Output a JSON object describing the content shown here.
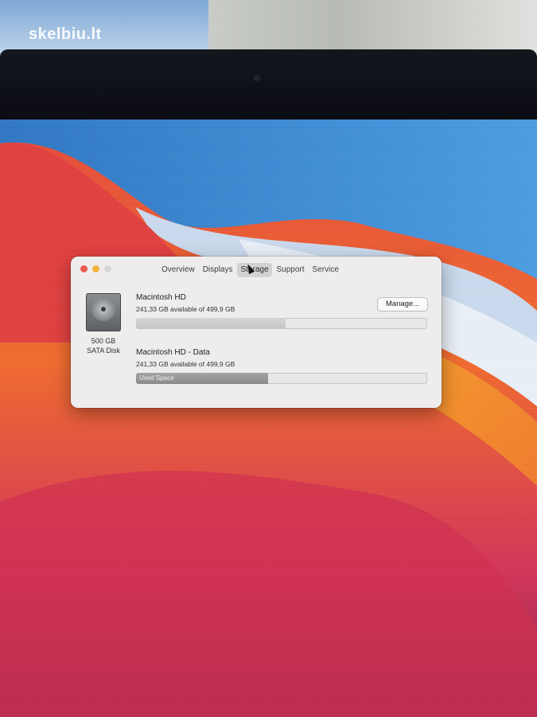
{
  "photo": {
    "watermark": "skelbiu.lt"
  },
  "dialog": {
    "tabs": [
      "Overview",
      "Displays",
      "Storage",
      "Support",
      "Service"
    ],
    "active_tab": "Storage",
    "disk": {
      "icon": "hard-disk-icon",
      "size_label": "500 GB",
      "type_label": "SATA Disk"
    },
    "volumes": [
      {
        "name": "Macintosh HD",
        "available": "241,33 GB available of 499,9 GB",
        "bar_label": ""
      },
      {
        "name": "Macintosh HD - Data",
        "available": "241,33 GB available of 499,9 GB",
        "bar_label": "Used Space"
      }
    ],
    "manage_label": "Manage...",
    "used_fraction": 0.517
  },
  "colors": {
    "traffic_close": "#ee5a50",
    "traffic_min": "#f3b33c",
    "traffic_zoom": "#d6d4d4",
    "dialog_bg": "#eeecec",
    "bar_fill": "#8c8a8a"
  }
}
